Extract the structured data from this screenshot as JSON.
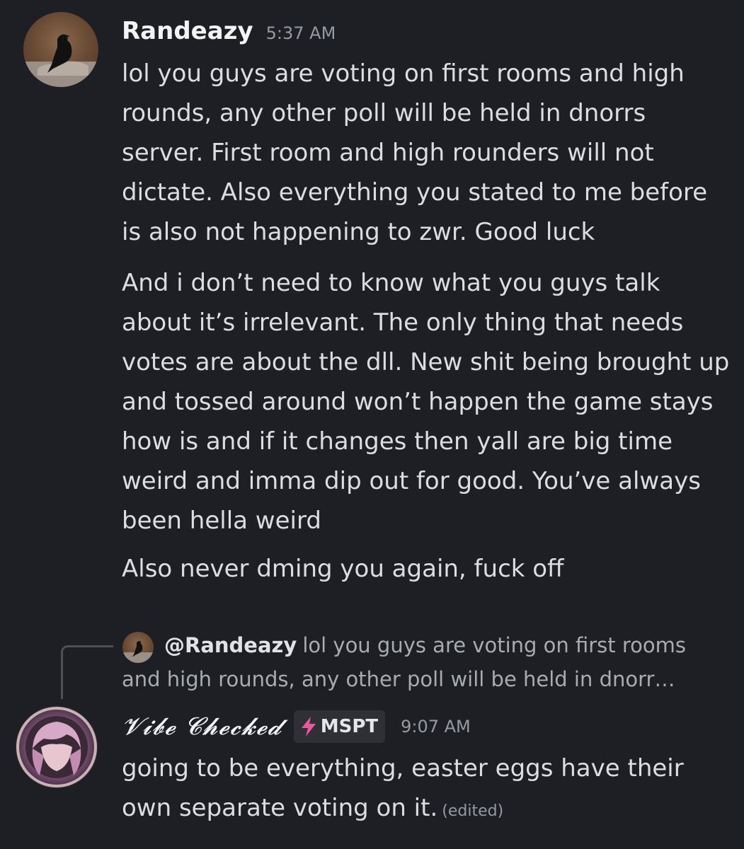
{
  "message1": {
    "username": "Randeazy",
    "timestamp": "5:37 AM",
    "avatar_icon": "crow-avatar-icon",
    "paragraphs": [
      "lol you guys are voting on first rooms and high rounds, any other poll will be held in dnorrs server. First room and high rounders will not dictate. Also everything you stated to me before is also not happening to zwr. Good luck",
      "And i don’t need to know what you guys talk about it’s irrelevant. The only thing that needs votes are about the dll. New shit being brought up and tossed around won’t happen the game stays how is and if it changes then yall are big time weird and imma dip out for good. You’ve always been hella weird",
      "Also never dming you again, fuck off"
    ]
  },
  "reply": {
    "mention": "@Randeazy",
    "preview": "lol you guys are voting on first rooms and high rounds, any other poll will be held in dnorr…"
  },
  "message2": {
    "username": "𝓥𝓲𝓫𝓮 𝓒𝓱𝓮𝓬𝓴𝓮𝓭",
    "tag": "MSPT",
    "tag_icon": "lightning-bolt-icon",
    "tag_color": "#e8589c",
    "timestamp": "9:07 AM",
    "text": "going to be everything, easter eggs have their own separate voting on it.",
    "edited": "(edited)"
  }
}
